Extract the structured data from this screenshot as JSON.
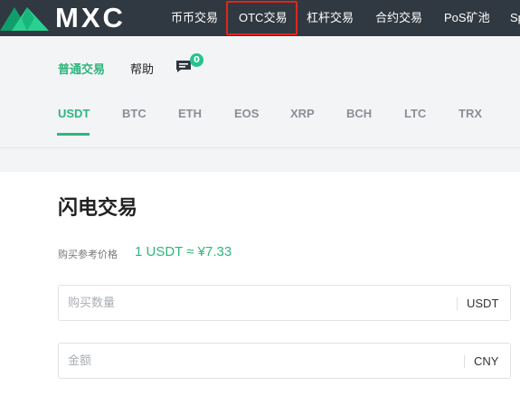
{
  "header": {
    "logo_text": "MXC",
    "nav": [
      {
        "label": "币币交易"
      },
      {
        "label": "OTC交易",
        "highlighted": true
      },
      {
        "label": "杠杆交易"
      },
      {
        "label": "合约交易"
      },
      {
        "label": "PoS矿池"
      },
      {
        "label": "Sp"
      }
    ],
    "colors": {
      "background": "#303841",
      "highlight_border": "#e0271f"
    }
  },
  "subnav": {
    "items": [
      {
        "label": "普通交易",
        "active": true
      },
      {
        "label": "帮助"
      }
    ],
    "chat": {
      "icon": "chat-icon",
      "badge": "0"
    }
  },
  "coin_tabs": {
    "items": [
      "USDT",
      "BTC",
      "ETH",
      "EOS",
      "XRP",
      "BCH",
      "LTC",
      "TRX"
    ],
    "active": "USDT"
  },
  "main": {
    "title": "闪电交易",
    "reference_price_label": "购买参考价格",
    "reference_price_value": "1 USDT ≈ ¥7.33",
    "fields": [
      {
        "placeholder": "购买数量",
        "unit": "USDT"
      },
      {
        "placeholder": "金额",
        "unit": "CNY"
      }
    ]
  },
  "colors": {
    "accent": "#2eb67d",
    "badge": "#25c48b"
  }
}
